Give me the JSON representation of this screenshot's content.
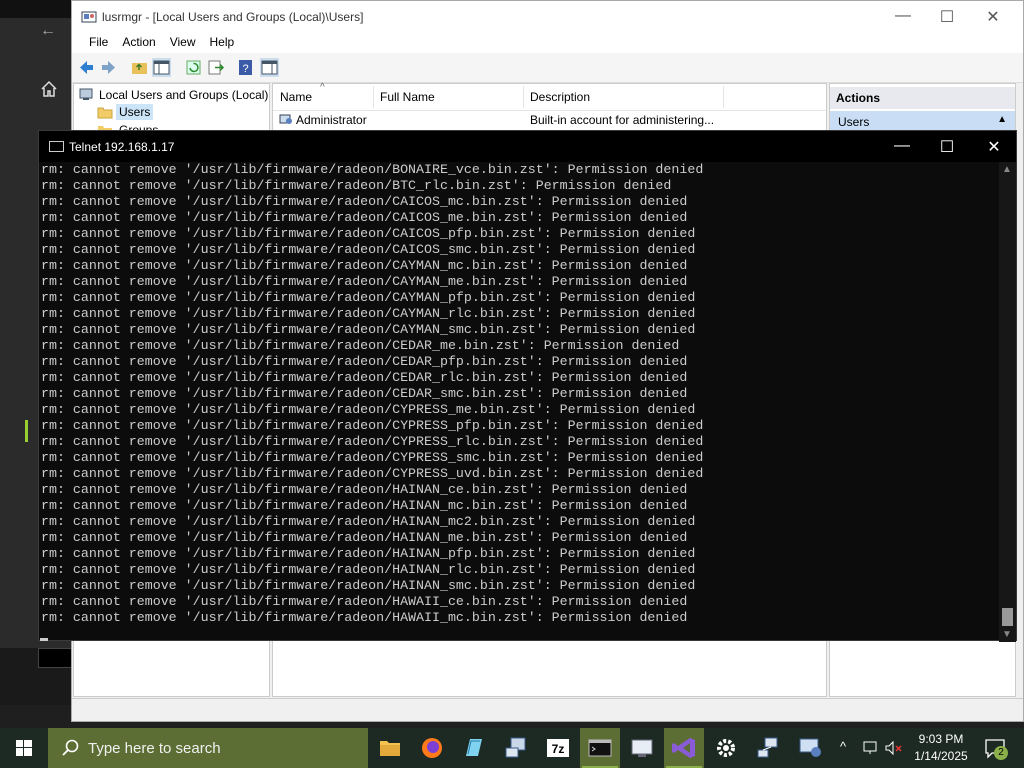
{
  "colors": {
    "taskbar_bg": "#1c2a23",
    "search_bg": "#5c6e33",
    "terminal_bg": "#0c0c0c",
    "terminal_fg": "#cccccc",
    "accent": "#8bb04a"
  },
  "mmc": {
    "title": "lusrmgr - [Local Users and Groups (Local)\\Users]",
    "menu": [
      "File",
      "Action",
      "View",
      "Help"
    ],
    "tree": {
      "root": "Local Users and Groups (Local)",
      "users": "Users",
      "groups": "Groups"
    },
    "columns": [
      "Name",
      "Full Name",
      "Description"
    ],
    "rows": [
      {
        "name": "Administrator",
        "full_name": "",
        "description": "Built-in account for administering..."
      }
    ],
    "actions": {
      "header": "Actions",
      "selected": "Users"
    }
  },
  "telnet": {
    "title": "Telnet 192.168.1.17",
    "lines": [
      "rm: cannot remove '/usr/lib/firmware/radeon/BONAIRE_vce.bin.zst': Permission denied",
      "rm: cannot remove '/usr/lib/firmware/radeon/BTC_rlc.bin.zst': Permission denied",
      "rm: cannot remove '/usr/lib/firmware/radeon/CAICOS_mc.bin.zst': Permission denied",
      "rm: cannot remove '/usr/lib/firmware/radeon/CAICOS_me.bin.zst': Permission denied",
      "rm: cannot remove '/usr/lib/firmware/radeon/CAICOS_pfp.bin.zst': Permission denied",
      "rm: cannot remove '/usr/lib/firmware/radeon/CAICOS_smc.bin.zst': Permission denied",
      "rm: cannot remove '/usr/lib/firmware/radeon/CAYMAN_mc.bin.zst': Permission denied",
      "rm: cannot remove '/usr/lib/firmware/radeon/CAYMAN_me.bin.zst': Permission denied",
      "rm: cannot remove '/usr/lib/firmware/radeon/CAYMAN_pfp.bin.zst': Permission denied",
      "rm: cannot remove '/usr/lib/firmware/radeon/CAYMAN_rlc.bin.zst': Permission denied",
      "rm: cannot remove '/usr/lib/firmware/radeon/CAYMAN_smc.bin.zst': Permission denied",
      "rm: cannot remove '/usr/lib/firmware/radeon/CEDAR_me.bin.zst': Permission denied",
      "rm: cannot remove '/usr/lib/firmware/radeon/CEDAR_pfp.bin.zst': Permission denied",
      "rm: cannot remove '/usr/lib/firmware/radeon/CEDAR_rlc.bin.zst': Permission denied",
      "rm: cannot remove '/usr/lib/firmware/radeon/CEDAR_smc.bin.zst': Permission denied",
      "rm: cannot remove '/usr/lib/firmware/radeon/CYPRESS_me.bin.zst': Permission denied",
      "rm: cannot remove '/usr/lib/firmware/radeon/CYPRESS_pfp.bin.zst': Permission denied",
      "rm: cannot remove '/usr/lib/firmware/radeon/CYPRESS_rlc.bin.zst': Permission denied",
      "rm: cannot remove '/usr/lib/firmware/radeon/CYPRESS_smc.bin.zst': Permission denied",
      "rm: cannot remove '/usr/lib/firmware/radeon/CYPRESS_uvd.bin.zst': Permission denied",
      "rm: cannot remove '/usr/lib/firmware/radeon/HAINAN_ce.bin.zst': Permission denied",
      "rm: cannot remove '/usr/lib/firmware/radeon/HAINAN_mc.bin.zst': Permission denied",
      "rm: cannot remove '/usr/lib/firmware/radeon/HAINAN_mc2.bin.zst': Permission denied",
      "rm: cannot remove '/usr/lib/firmware/radeon/HAINAN_me.bin.zst': Permission denied",
      "rm: cannot remove '/usr/lib/firmware/radeon/HAINAN_pfp.bin.zst': Permission denied",
      "rm: cannot remove '/usr/lib/firmware/radeon/HAINAN_rlc.bin.zst': Permission denied",
      "rm: cannot remove '/usr/lib/firmware/radeon/HAINAN_smc.bin.zst': Permission denied",
      "rm: cannot remove '/usr/lib/firmware/radeon/HAWAII_ce.bin.zst': Permission denied",
      "rm: cannot remove '/usr/lib/firmware/radeon/HAWAII_mc.bin.zst': Permission denied"
    ]
  },
  "taskbar": {
    "search_placeholder": "Type here to search",
    "apps": [
      {
        "icon": "file-explorer-icon"
      },
      {
        "icon": "firefox-icon"
      },
      {
        "icon": "notepad-icon"
      },
      {
        "icon": "network-computer-icon"
      },
      {
        "icon": "7zip-icon",
        "label": "7z"
      },
      {
        "icon": "terminal-icon"
      },
      {
        "icon": "remote-desktop-icon"
      },
      {
        "icon": "visual-studio-icon"
      },
      {
        "icon": "settings-gear-icon"
      },
      {
        "icon": "network-admin-icon"
      },
      {
        "icon": "computer-management-icon"
      }
    ],
    "time": "9:03 PM",
    "date": "1/14/2025",
    "notification_count": "2"
  }
}
